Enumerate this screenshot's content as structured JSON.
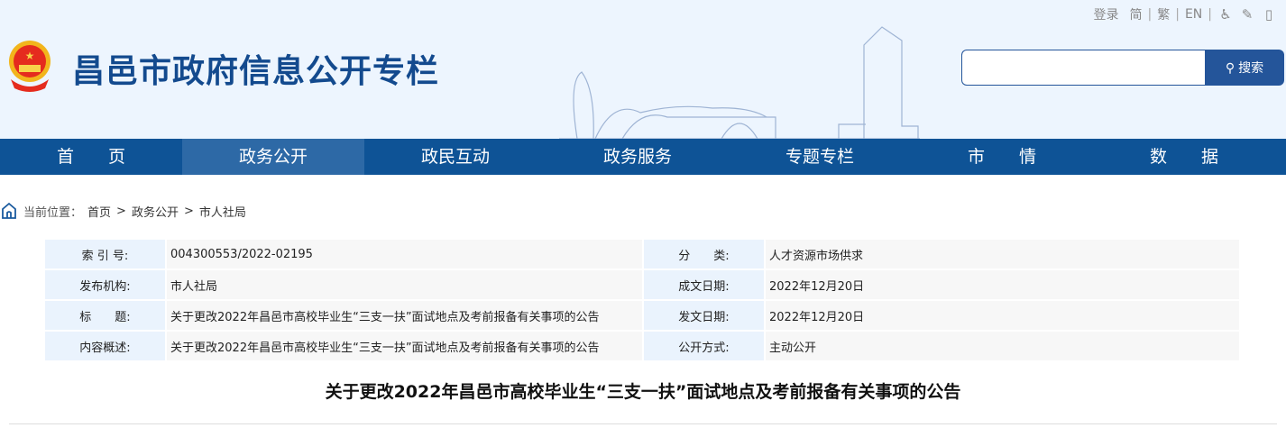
{
  "top": {
    "login": "登录",
    "simplified": "简",
    "traditional": "繁",
    "english": "EN"
  },
  "site_title": "昌邑市政府信息公开专栏",
  "search": {
    "placeholder": "",
    "button": "搜索"
  },
  "nav": [
    "首　　页",
    "政务公开",
    "政民互动",
    "政务服务",
    "专题专栏",
    "市　　情",
    "数　　据"
  ],
  "breadcrumb": {
    "label": "当前位置：",
    "items": [
      "首页",
      "政务公开",
      "市人社局"
    ]
  },
  "meta": [
    {
      "l1": "索 引 号:",
      "v1": "004300553/2022-02195",
      "l2": "分　　类:",
      "v2": "人才资源市场供求"
    },
    {
      "l1": "发布机构:",
      "v1": "市人社局",
      "l2": "成文日期:",
      "v2": "2022年12月20日"
    },
    {
      "l1": "标　　题:",
      "v1": "关于更改2022年昌邑市高校毕业生“三支一扶”面试地点及考前报备有关事项的公告",
      "l2": "发文日期:",
      "v2": "2022年12月20日"
    },
    {
      "l1": "内容概述:",
      "v1": "关于更改2022年昌邑市高校毕业生“三支一扶”面试地点及考前报备有关事项的公告",
      "l2": "公开方式:",
      "v2": "主动公开"
    }
  ],
  "article_title": "关于更改2022年昌邑市高校毕业生“三支一扶”面试地点及考前报备有关事项的公告"
}
